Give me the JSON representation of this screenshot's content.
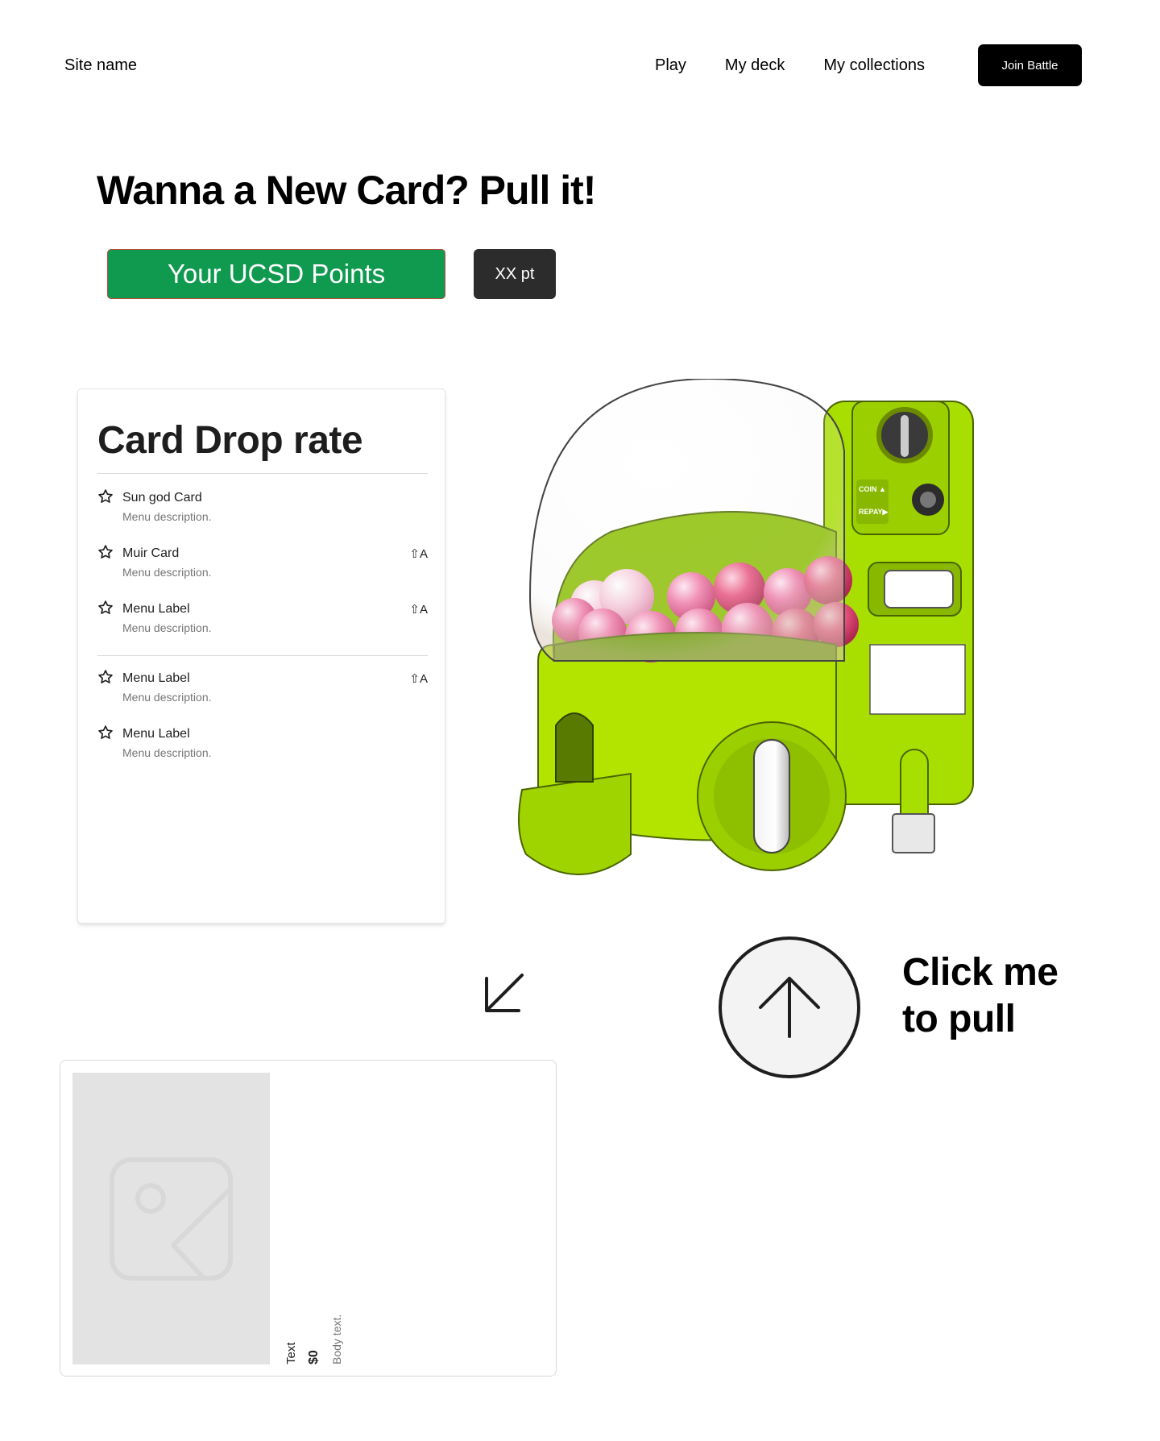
{
  "nav": {
    "site_name": "Site name",
    "links": [
      "Play",
      "My deck",
      "My collections"
    ],
    "join_label": "Join Battle"
  },
  "hero": {
    "title": "Wanna a New Card? Pull it!",
    "points_label": "Your UCSD Points",
    "points_value": "XX pt"
  },
  "drop_rate": {
    "title": "Card Drop rate",
    "items": [
      {
        "label": "Sun god Card",
        "description": "Menu description.",
        "shortcut": ""
      },
      {
        "label": "Muir Card",
        "description": "Menu description.",
        "shortcut": "⇧A"
      },
      {
        "label": "Menu Label",
        "description": "Menu description.",
        "shortcut": "⇧A"
      },
      {
        "label": "Menu Label",
        "description": "Menu description.",
        "shortcut": "⇧A"
      },
      {
        "label": "Menu Label",
        "description": "Menu description.",
        "shortcut": ""
      }
    ]
  },
  "machine": {
    "coin_label": "COIN ▲",
    "repay_label": "REPAY▶",
    "accent_color": "#b2e400"
  },
  "pull": {
    "line1": "Click me",
    "line2": "to pull"
  },
  "product": {
    "text": "Text",
    "price": "$0",
    "body": "Body text."
  }
}
